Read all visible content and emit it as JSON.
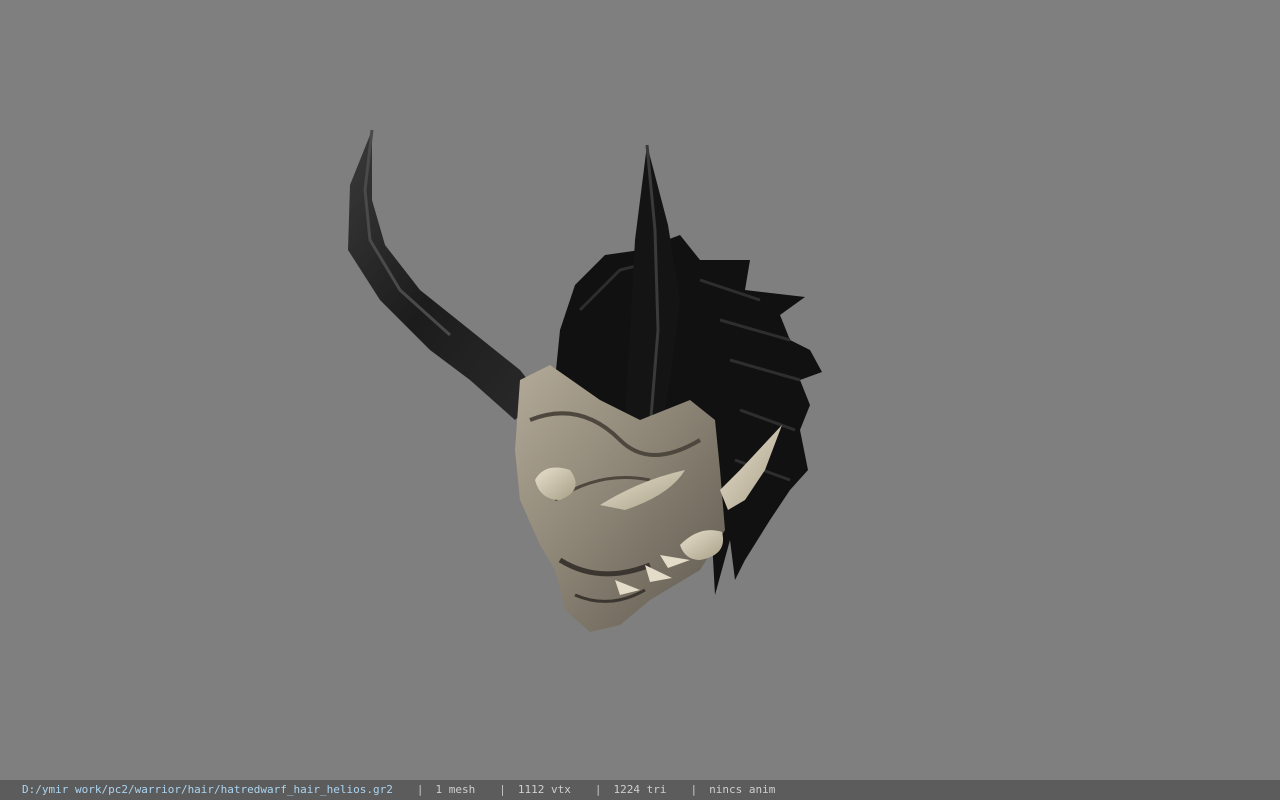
{
  "viewport": {
    "background": "#7f7f7f",
    "model_name": "hatredwarf_hair_helios"
  },
  "statusbar": {
    "file_path": "D:/ymir work/pc2/warrior/hair/hatredwarf_hair_helios.gr2",
    "separator": "|",
    "mesh_count": "1 mesh",
    "vertex_count": "1112 vtx",
    "triangle_count": "1224 tri",
    "anim_status": "nincs anim"
  }
}
